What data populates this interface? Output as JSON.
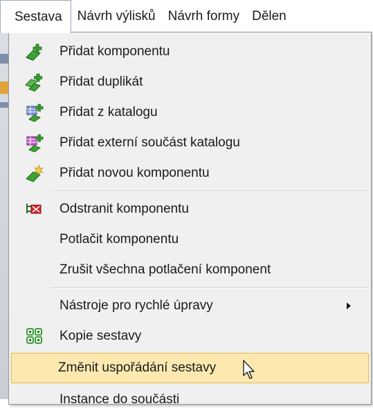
{
  "menubar": {
    "items": [
      {
        "label": "Sestava"
      },
      {
        "label": "Návrh výlisků"
      },
      {
        "label": "Návrh formy"
      },
      {
        "label": "Dělen"
      }
    ]
  },
  "dropdown": {
    "items": [
      {
        "label": "Přidat komponentu",
        "icon": "add-component-icon"
      },
      {
        "label": "Přidat duplikát",
        "icon": "add-duplicate-icon"
      },
      {
        "label": "Přidat z katalogu",
        "icon": "add-from-catalog-icon"
      },
      {
        "label": "Přidat externí součást katalogu",
        "icon": "add-external-catalog-part-icon"
      },
      {
        "label": "Přidat novou komponentu",
        "icon": "add-new-component-icon"
      },
      {
        "label": "Odstranit komponentu",
        "icon": "remove-component-icon"
      },
      {
        "label": "Potlačit komponentu"
      },
      {
        "label": "Zrušit všechna potlačení komponent"
      },
      {
        "label": "Nástroje pro rychlé úpravy",
        "submenu": true
      },
      {
        "label": "Kopie sestavy",
        "icon": "copy-assembly-icon"
      },
      {
        "label": "Změnit uspořádání sestavy",
        "highlighted": true
      },
      {
        "label": "Instance do součásti"
      }
    ]
  },
  "colors": {
    "menu_background": "#f0f0f0",
    "highlight_fill": "#fde9b0",
    "highlight_border": "#e3b94a",
    "icon_green": "#3aa334",
    "icon_red": "#d6252a"
  }
}
